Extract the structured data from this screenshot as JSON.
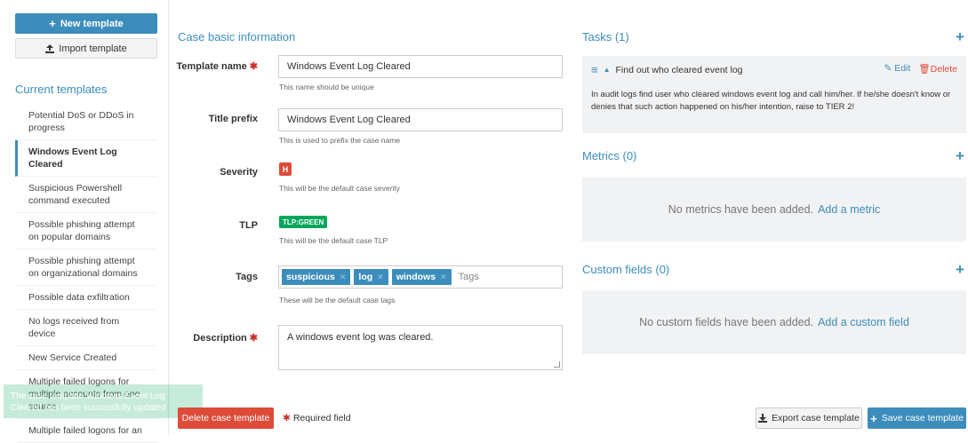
{
  "sidebar": {
    "new_template_label": "New template",
    "import_template_label": "Import template",
    "current_templates_title": "Current templates",
    "templates": [
      {
        "label": "Potential DoS or DDoS in progress",
        "active": false
      },
      {
        "label": "Windows Event Log Cleared",
        "active": true
      },
      {
        "label": "Suspicious Powershell command executed",
        "active": false
      },
      {
        "label": "Possible phishing attempt on popular domains",
        "active": false
      },
      {
        "label": "Possible phishing attempt on organizational domains",
        "active": false
      },
      {
        "label": "Possible data exfiltration",
        "active": false
      },
      {
        "label": "No logs received from device",
        "active": false
      },
      {
        "label": "New Service Created",
        "active": false
      },
      {
        "label": "Multiple failed logons for multiple accounts from one source",
        "active": false
      },
      {
        "label": "Multiple failed logons for an",
        "active": false
      }
    ],
    "toast": "The case template Windows Event Log Cleared has been successfully updated"
  },
  "form": {
    "section_title": "Case basic information",
    "template_name_label": "Template name",
    "template_name_value": "Windows Event Log Cleared",
    "template_name_help": "This name should be unique",
    "title_prefix_label": "Title prefix",
    "title_prefix_value": "Windows Event Log Cleared",
    "title_prefix_help": "This is used to prefix the case name",
    "severity_label": "Severity",
    "severity_value": "H",
    "severity_help": "This will be the default case severity",
    "tlp_label": "TLP",
    "tlp_value": "TLP:GREEN",
    "tlp_help": "This will be the default case TLP",
    "tags_label": "Tags",
    "tags": [
      "suspicious",
      "log",
      "windows"
    ],
    "tags_placeholder": "Tags",
    "tags_help": "These will be the default case tags",
    "description_label": "Description",
    "description_value": "A windows event log was cleared.",
    "required_star": "✱",
    "delete_button": "Delete case template",
    "required_field_text": "Required field"
  },
  "tasks": {
    "title": "Tasks (1)",
    "items": [
      {
        "title": "Find out who cleared event log",
        "edit_label": "Edit",
        "delete_label": "Delete",
        "description": "In audit logs find user who cleared windows event log and call him/her. If he/she doesn't know or denies that such action happened on his/her intention, raise to TIER 2!"
      }
    ]
  },
  "metrics": {
    "title": "Metrics (0)",
    "empty_text": "No metrics have been added.",
    "add_link": "Add a metric"
  },
  "custom_fields": {
    "title": "Custom fields (0)",
    "empty_text": "No custom fields have been added.",
    "add_link": "Add a custom field"
  },
  "footer": {
    "export_button": "Export case template",
    "save_button": "Save case template"
  },
  "colors": {
    "primary": "#3c8dbc",
    "danger": "#dd4b39",
    "success": "#00a65a"
  }
}
